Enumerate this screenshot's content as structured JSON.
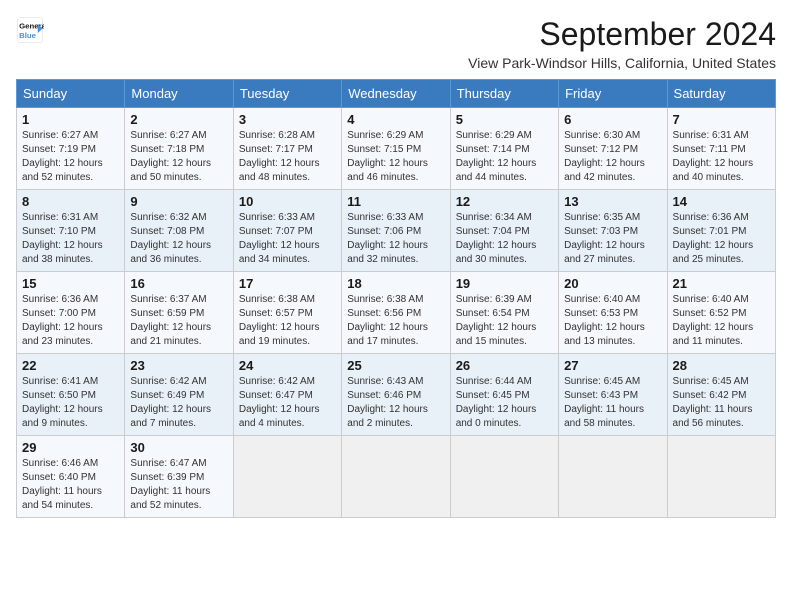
{
  "header": {
    "logo_line1": "General",
    "logo_line2": "Blue",
    "title": "September 2024",
    "location": "View Park-Windsor Hills, California, United States"
  },
  "weekdays": [
    "Sunday",
    "Monday",
    "Tuesday",
    "Wednesday",
    "Thursday",
    "Friday",
    "Saturday"
  ],
  "weeks": [
    [
      {
        "day": "1",
        "info": "Sunrise: 6:27 AM\nSunset: 7:19 PM\nDaylight: 12 hours\nand 52 minutes."
      },
      {
        "day": "2",
        "info": "Sunrise: 6:27 AM\nSunset: 7:18 PM\nDaylight: 12 hours\nand 50 minutes."
      },
      {
        "day": "3",
        "info": "Sunrise: 6:28 AM\nSunset: 7:17 PM\nDaylight: 12 hours\nand 48 minutes."
      },
      {
        "day": "4",
        "info": "Sunrise: 6:29 AM\nSunset: 7:15 PM\nDaylight: 12 hours\nand 46 minutes."
      },
      {
        "day": "5",
        "info": "Sunrise: 6:29 AM\nSunset: 7:14 PM\nDaylight: 12 hours\nand 44 minutes."
      },
      {
        "day": "6",
        "info": "Sunrise: 6:30 AM\nSunset: 7:12 PM\nDaylight: 12 hours\nand 42 minutes."
      },
      {
        "day": "7",
        "info": "Sunrise: 6:31 AM\nSunset: 7:11 PM\nDaylight: 12 hours\nand 40 minutes."
      }
    ],
    [
      {
        "day": "8",
        "info": "Sunrise: 6:31 AM\nSunset: 7:10 PM\nDaylight: 12 hours\nand 38 minutes."
      },
      {
        "day": "9",
        "info": "Sunrise: 6:32 AM\nSunset: 7:08 PM\nDaylight: 12 hours\nand 36 minutes."
      },
      {
        "day": "10",
        "info": "Sunrise: 6:33 AM\nSunset: 7:07 PM\nDaylight: 12 hours\nand 34 minutes."
      },
      {
        "day": "11",
        "info": "Sunrise: 6:33 AM\nSunset: 7:06 PM\nDaylight: 12 hours\nand 32 minutes."
      },
      {
        "day": "12",
        "info": "Sunrise: 6:34 AM\nSunset: 7:04 PM\nDaylight: 12 hours\nand 30 minutes."
      },
      {
        "day": "13",
        "info": "Sunrise: 6:35 AM\nSunset: 7:03 PM\nDaylight: 12 hours\nand 27 minutes."
      },
      {
        "day": "14",
        "info": "Sunrise: 6:36 AM\nSunset: 7:01 PM\nDaylight: 12 hours\nand 25 minutes."
      }
    ],
    [
      {
        "day": "15",
        "info": "Sunrise: 6:36 AM\nSunset: 7:00 PM\nDaylight: 12 hours\nand 23 minutes."
      },
      {
        "day": "16",
        "info": "Sunrise: 6:37 AM\nSunset: 6:59 PM\nDaylight: 12 hours\nand 21 minutes."
      },
      {
        "day": "17",
        "info": "Sunrise: 6:38 AM\nSunset: 6:57 PM\nDaylight: 12 hours\nand 19 minutes."
      },
      {
        "day": "18",
        "info": "Sunrise: 6:38 AM\nSunset: 6:56 PM\nDaylight: 12 hours\nand 17 minutes."
      },
      {
        "day": "19",
        "info": "Sunrise: 6:39 AM\nSunset: 6:54 PM\nDaylight: 12 hours\nand 15 minutes."
      },
      {
        "day": "20",
        "info": "Sunrise: 6:40 AM\nSunset: 6:53 PM\nDaylight: 12 hours\nand 13 minutes."
      },
      {
        "day": "21",
        "info": "Sunrise: 6:40 AM\nSunset: 6:52 PM\nDaylight: 12 hours\nand 11 minutes."
      }
    ],
    [
      {
        "day": "22",
        "info": "Sunrise: 6:41 AM\nSunset: 6:50 PM\nDaylight: 12 hours\nand 9 minutes."
      },
      {
        "day": "23",
        "info": "Sunrise: 6:42 AM\nSunset: 6:49 PM\nDaylight: 12 hours\nand 7 minutes."
      },
      {
        "day": "24",
        "info": "Sunrise: 6:42 AM\nSunset: 6:47 PM\nDaylight: 12 hours\nand 4 minutes."
      },
      {
        "day": "25",
        "info": "Sunrise: 6:43 AM\nSunset: 6:46 PM\nDaylight: 12 hours\nand 2 minutes."
      },
      {
        "day": "26",
        "info": "Sunrise: 6:44 AM\nSunset: 6:45 PM\nDaylight: 12 hours\nand 0 minutes."
      },
      {
        "day": "27",
        "info": "Sunrise: 6:45 AM\nSunset: 6:43 PM\nDaylight: 11 hours\nand 58 minutes."
      },
      {
        "day": "28",
        "info": "Sunrise: 6:45 AM\nSunset: 6:42 PM\nDaylight: 11 hours\nand 56 minutes."
      }
    ],
    [
      {
        "day": "29",
        "info": "Sunrise: 6:46 AM\nSunset: 6:40 PM\nDaylight: 11 hours\nand 54 minutes."
      },
      {
        "day": "30",
        "info": "Sunrise: 6:47 AM\nSunset: 6:39 PM\nDaylight: 11 hours\nand 52 minutes."
      },
      {
        "day": "",
        "info": ""
      },
      {
        "day": "",
        "info": ""
      },
      {
        "day": "",
        "info": ""
      },
      {
        "day": "",
        "info": ""
      },
      {
        "day": "",
        "info": ""
      }
    ]
  ]
}
